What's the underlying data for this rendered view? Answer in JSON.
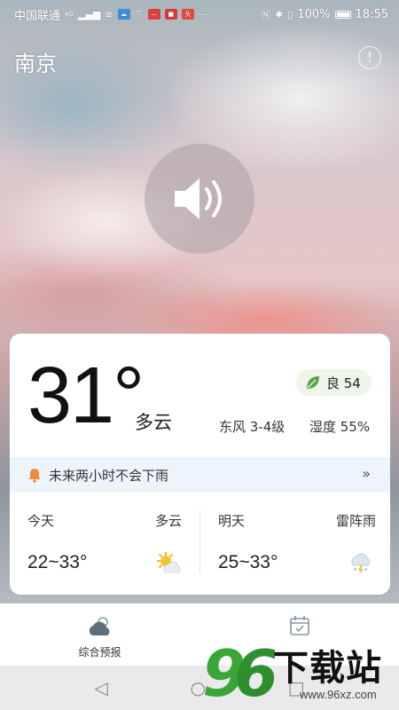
{
  "status_bar": {
    "carrier": "中国联通",
    "network_badge": "4G",
    "battery_text": "100%",
    "time": "18:55"
  },
  "header": {
    "city": "南京",
    "info_icon": "info-icon"
  },
  "current": {
    "temperature": "31°",
    "condition": "多云",
    "aqi_label": "良 54",
    "aqi_color": "#5aa34a",
    "wind": "东风 3-4级",
    "humidity": "湿度 55%"
  },
  "rain_notice": {
    "text": "未来两小时不会下雨",
    "more": "»"
  },
  "forecast": [
    {
      "label": "今天",
      "condition": "多云",
      "range": "22~33°",
      "icon": "sun-cloud-icon"
    },
    {
      "label": "明天",
      "condition": "雷阵雨",
      "range": "25~33°",
      "icon": "thunderstorm-icon"
    }
  ],
  "bottom_nav": {
    "items": [
      {
        "label": "综合预报",
        "icon": "cloud-icon"
      },
      {
        "label": "",
        "icon": "calendar-icon"
      }
    ]
  },
  "watermark": {
    "brand": "96",
    "text": "下载站",
    "url": "www.96xz.com"
  },
  "colors": {
    "card_bg": "#ffffff",
    "rain_bar_bg": "#eef4fb",
    "bell": "#f08a3c"
  }
}
